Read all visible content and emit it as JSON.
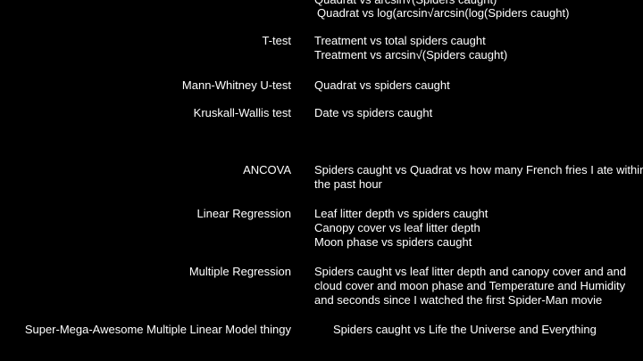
{
  "top_lines": [
    "Quadrat vs arcsin√(Spiders caught)",
    "Quadrat vs log(arcsin√arcsin(log(Spiders caught)"
  ],
  "rows": [
    {
      "test": "T-test",
      "lines": [
        "Treatment vs total spiders caught",
        "Treatment vs arcsin√(Spiders caught)"
      ]
    },
    {
      "test": "Mann-Whitney U-test",
      "lines": [
        "Quadrat vs spiders caught"
      ]
    },
    {
      "test": "Kruskall-Wallis test",
      "lines": [
        "Date vs spiders caught"
      ]
    },
    {
      "test": "ANCOVA",
      "lines": [
        "Spiders caught vs Quadrat vs how many French fries I ate within",
        "the past hour"
      ]
    },
    {
      "test": "Linear Regression",
      "lines": [
        "Leaf litter depth vs spiders caught",
        "Canopy cover vs leaf  litter depth",
        "Moon phase vs  spiders caught"
      ]
    },
    {
      "test": "Multiple Regression",
      "lines": [
        "Spiders caught vs leaf litter depth and canopy cover and and",
        "cloud cover and moon phase and Temperature and Humidity",
        "and seconds since I watched the first Spider-Man movie"
      ]
    },
    {
      "test": "Super-Mega-Awesome Multiple Linear  Model thingy",
      "lines": [
        "Spiders caught vs Life the Universe and Everything"
      ]
    }
  ]
}
